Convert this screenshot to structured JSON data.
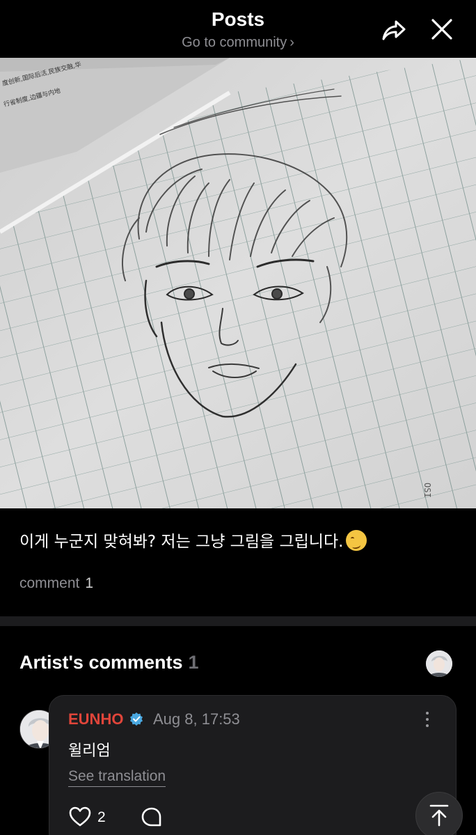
{
  "header": {
    "title": "Posts",
    "subtitle": "Go to community",
    "subtitle_chevron": "›",
    "share_icon": "share-forward-icon",
    "close_icon": "close-icon"
  },
  "post": {
    "image_description_icon": "pencil-sketch-photo",
    "text": "이게 누군지 맞혀봐? 저는 그냥 그림을 그립니다.",
    "emoji_icon": "woozy-face-emoji",
    "comment_label": "comment",
    "comment_count": "1"
  },
  "artist_comments": {
    "heading": "Artist's comments",
    "count": "1",
    "items": [
      {
        "author": "EUNHO",
        "verified_icon": "verified-badge-icon",
        "date": "Aug 8, 17:53",
        "body": "윌리엄",
        "translate_label": "See translation",
        "like_count": "2"
      }
    ]
  },
  "colors": {
    "background": "#000000",
    "author": "#e0453a",
    "verified": "#4aa8e0",
    "muted": "#8e8e93",
    "card": "#1c1c1e"
  }
}
